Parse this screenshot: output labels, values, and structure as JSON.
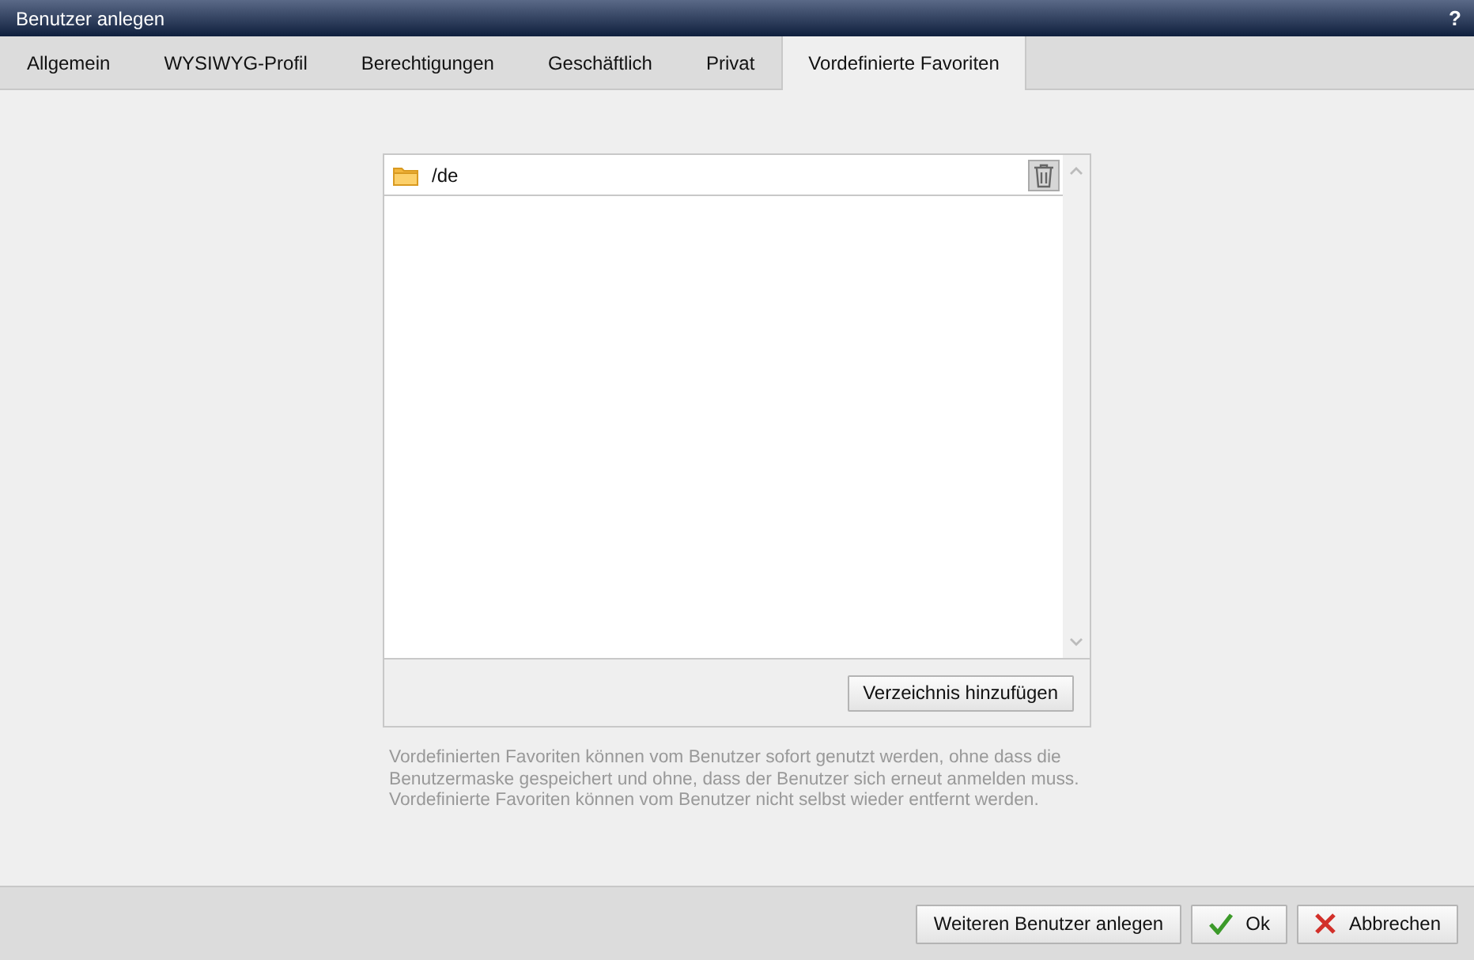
{
  "window": {
    "title": "Benutzer anlegen",
    "help": "?"
  },
  "tabs": [
    {
      "label": "Allgemein",
      "selected": false
    },
    {
      "label": "WYSIWYG-Profil",
      "selected": false
    },
    {
      "label": "Berechtigungen",
      "selected": false
    },
    {
      "label": "Geschäftlich",
      "selected": false
    },
    {
      "label": "Privat",
      "selected": false
    },
    {
      "label": "Vordefinierte Favoriten",
      "selected": true
    }
  ],
  "favorites": [
    {
      "path": "/de"
    }
  ],
  "add_button": "Verzeichnis hinzufügen",
  "hint": "Vordefinierten Favoriten können vom Benutzer sofort genutzt werden, ohne dass die Benutzermaske gespeichert und ohne, dass der Benutzer sich erneut anmelden muss. Vordefinierte Favoriten können vom Benutzer nicht selbst wieder entfernt werden.",
  "buttons": [
    {
      "label": "Weiteren Benutzer anlegen",
      "kind": "plain"
    },
    {
      "label": "Ok",
      "kind": "ok"
    },
    {
      "label": "Abbrechen",
      "kind": "cancel"
    }
  ]
}
